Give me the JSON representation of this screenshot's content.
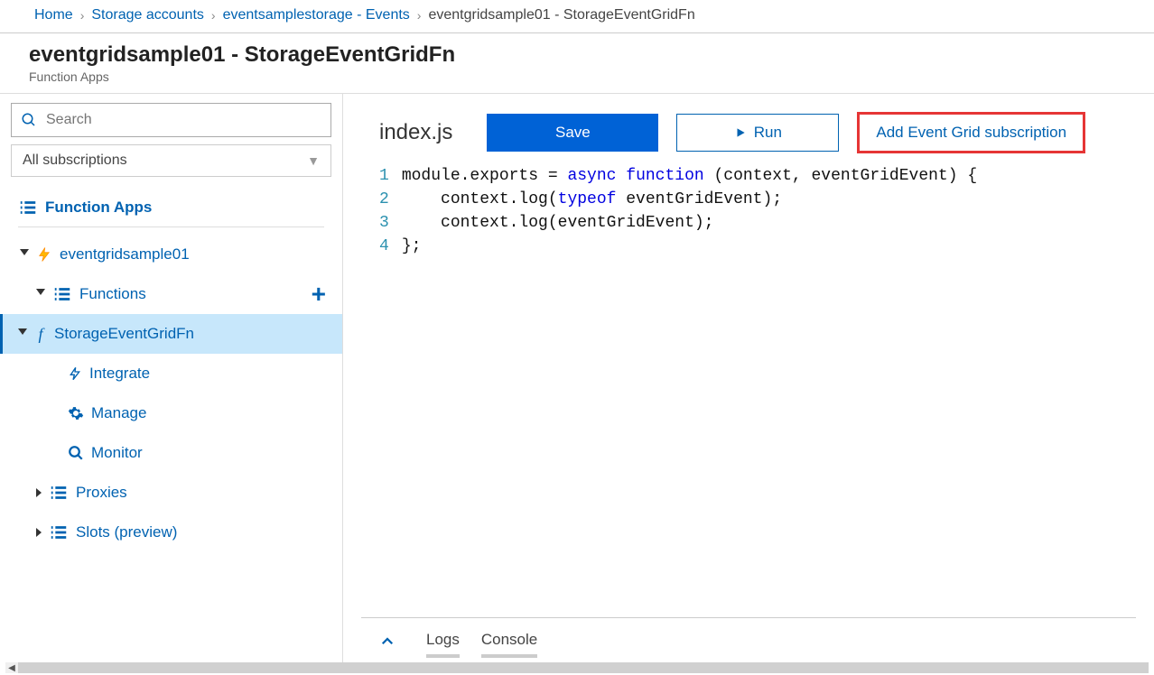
{
  "breadcrumb": {
    "home": "Home",
    "storage": "Storage accounts",
    "events": "eventsamplestorage - Events",
    "current": "eventgridsample01 - StorageEventGridFn"
  },
  "title": {
    "main": "eventgridsample01 - StorageEventGridFn",
    "subtitle": "Function Apps"
  },
  "sidebar": {
    "search_placeholder": "Search",
    "subscriptions": "All subscriptions",
    "function_apps": "Function Apps",
    "app_name": "eventgridsample01",
    "functions": "Functions",
    "fn_name": "StorageEventGridFn",
    "integrate": "Integrate",
    "manage": "Manage",
    "monitor": "Monitor",
    "proxies": "Proxies",
    "slots": "Slots (preview)"
  },
  "toolbar": {
    "filename": "index.js",
    "save": "Save",
    "run": "Run",
    "add_sub": "Add Event Grid subscription"
  },
  "code": {
    "lines": [
      {
        "n": "1"
      },
      {
        "n": "2"
      },
      {
        "n": "3"
      },
      {
        "n": "4"
      }
    ],
    "l1_a": "module",
    "l1_b": ".exports = ",
    "l1_c": "async function",
    "l1_d": " (context, eventGridEvent) {",
    "l2_a": "    context.log(",
    "l2_b": "typeof",
    "l2_c": " eventGridEvent);",
    "l3": "    context.log(eventGridEvent);",
    "l4": "};"
  },
  "bottom": {
    "logs": "Logs",
    "console": "Console"
  }
}
